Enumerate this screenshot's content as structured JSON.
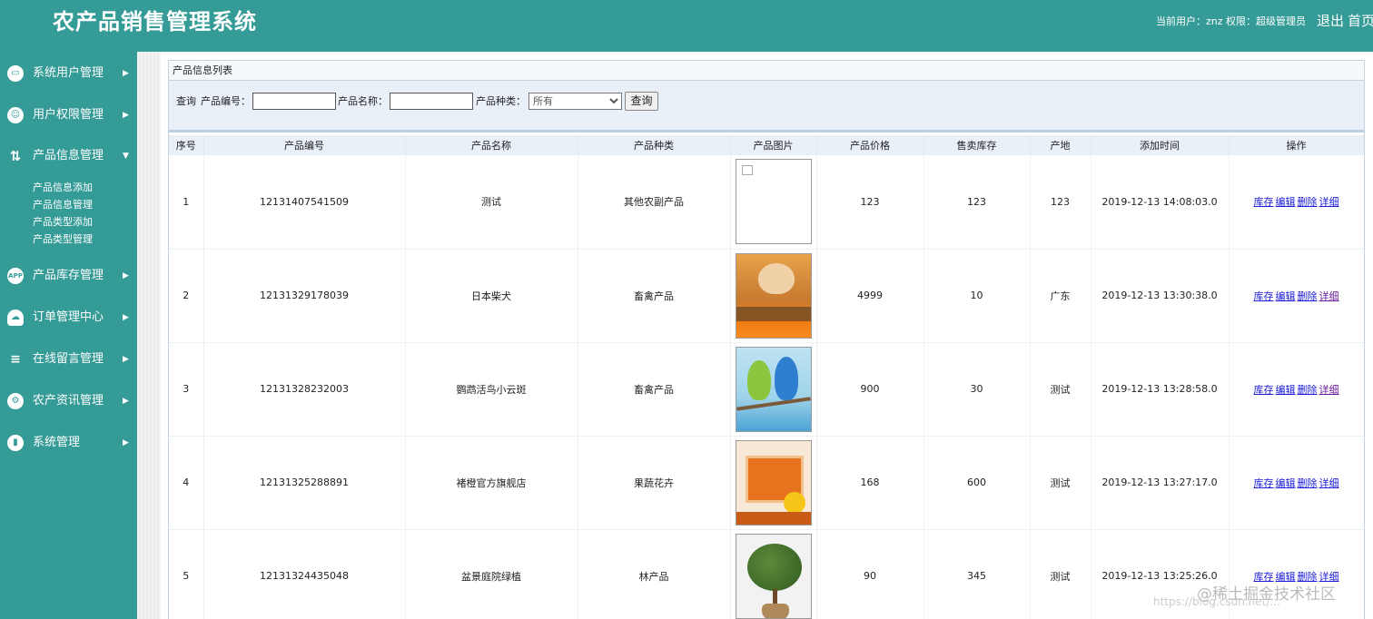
{
  "header": {
    "title": "农产品销售管理系统",
    "user_info": "当前用户：znz  权限：超级管理员",
    "logout": "退出",
    "home": "首页"
  },
  "sidebar": {
    "items": [
      {
        "label": "系统用户管理",
        "icon": "monitor-icon"
      },
      {
        "label": "用户权限管理",
        "icon": "user-gear-icon"
      },
      {
        "label": "产品信息管理",
        "icon": "arrows-icon",
        "expanded": true
      },
      {
        "label": "产品库存管理",
        "icon": "app-icon"
      },
      {
        "label": "订单管理中心",
        "icon": "cloud-icon"
      },
      {
        "label": "在线留言管理",
        "icon": "stack-icon"
      },
      {
        "label": "农产资讯管理",
        "icon": "gear-icon"
      },
      {
        "label": "系统管理",
        "icon": "bar-chart-icon"
      }
    ],
    "submenu": [
      "产品信息添加",
      "产品信息管理",
      "产品类型添加",
      "产品类型管理"
    ]
  },
  "panel": {
    "title": "产品信息列表"
  },
  "search": {
    "query_label": "查询",
    "code_label": "产品编号：",
    "name_label": "产品名称：",
    "type_label": "产品种类：",
    "type_selected": "所有",
    "submit": "查询"
  },
  "table": {
    "headers": [
      "序号",
      "产品编号",
      "产品名称",
      "产品种类",
      "产品图片",
      "产品价格",
      "售卖库存",
      "产地",
      "添加时间",
      "操作"
    ],
    "rows": [
      {
        "no": "1",
        "code": "12131407541509",
        "name": "测试",
        "type": "其他农副产品",
        "price": "123",
        "stock": "123",
        "origin": "123",
        "time": "2019-12-13 14:08:03.0"
      },
      {
        "no": "2",
        "code": "12131329178039",
        "name": "日本柴犬",
        "type": "畜禽产品",
        "price": "4999",
        "stock": "10",
        "origin": "广东",
        "time": "2019-12-13 13:30:38.0"
      },
      {
        "no": "3",
        "code": "12131328232003",
        "name": "鹦鹉活鸟小云斑",
        "type": "畜禽产品",
        "price": "900",
        "stock": "30",
        "origin": "测试",
        "time": "2019-12-13 13:28:58.0"
      },
      {
        "no": "4",
        "code": "12131325288891",
        "name": "褚橙官方旗舰店",
        "type": "果蔬花卉",
        "price": "168",
        "stock": "600",
        "origin": "测试",
        "time": "2019-12-13 13:27:17.0"
      },
      {
        "no": "5",
        "code": "12131324435048",
        "name": "盆景庭院绿植",
        "type": "林产品",
        "price": "90",
        "stock": "345",
        "origin": "测试",
        "time": "2019-12-13 13:25:26.0"
      }
    ],
    "ops": [
      "库存",
      "编辑",
      "删除",
      "详细"
    ]
  },
  "watermark": {
    "main": "@稀土掘金技术社区",
    "sub": "https://blog.csdn.net/..."
  },
  "colors": {
    "theme": "#349b97",
    "link": "#1a1ad8",
    "link_visited": "#6a1a9a"
  }
}
